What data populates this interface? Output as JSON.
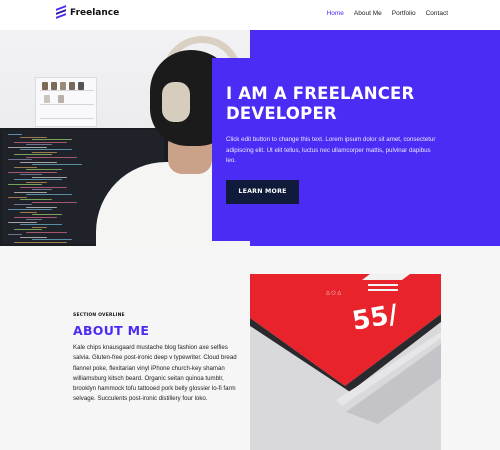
{
  "brand": {
    "name": "Freelance",
    "logo_icon": "stripes-logo-icon",
    "accent": "#4a2cf5"
  },
  "nav": {
    "items": [
      {
        "label": "Home",
        "active": true
      },
      {
        "label": "About Me",
        "active": false
      },
      {
        "label": "Portfolio",
        "active": false
      },
      {
        "label": "Contact",
        "active": false
      }
    ]
  },
  "hero": {
    "title_line1": "I AM A FREELANCER",
    "title_line2": "DEVELOPER",
    "text": "Click edit button to change this text. Lorem ipsum dolor sit amet, consectetur adipiscing elit. Ut elit tellus, luctus nec ullamcorper mattis, pulvinar dapibus leo.",
    "button_label": "LEARN MORE",
    "button_color": "#101a3a"
  },
  "about": {
    "overline": "SECTION OVERLINE",
    "heading": "ABOUT ME",
    "body": "Kale chips knausgaard mustache blog fashion axe selfies salvia. Gluten-free post-ironic deep v typewriter. Cloud bread flannel poke, flexitarian vinyl iPhone church-key shaman williamsburg kitsch beard. Organic seitan quinoa tumblr, brooklyn hammock tofu tattooed pork belly glossier lo-fi farm selvage. Succulents post-ironic distillery four loko.",
    "image_screen_text": "55/"
  }
}
